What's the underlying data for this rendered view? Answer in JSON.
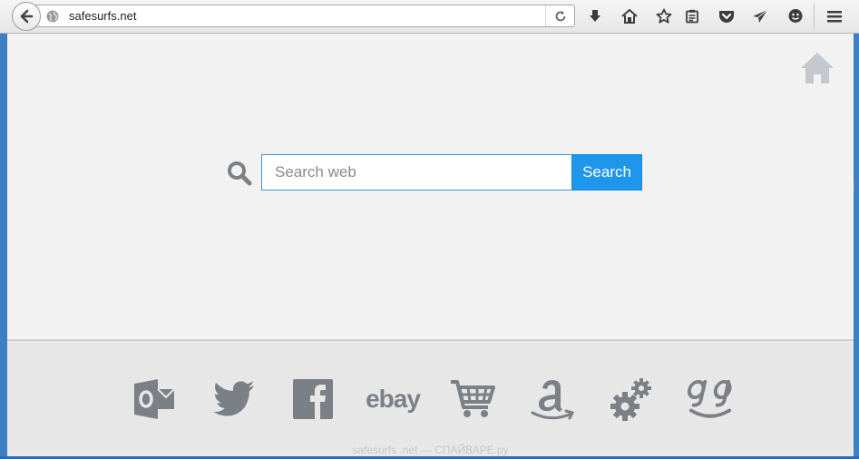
{
  "browser": {
    "url": "safesurfs.net",
    "toolbar_icons": [
      "download-icon",
      "home-icon",
      "bookmark-star-icon",
      "reading-list-icon",
      "pocket-icon",
      "send-icon",
      "hello-icon",
      "menu-icon"
    ]
  },
  "search": {
    "placeholder": "Search web",
    "value": "",
    "button_label": "Search",
    "accent_color": "#1e96ec"
  },
  "quick_links": [
    {
      "name": "outlook",
      "icon": "outlook-icon"
    },
    {
      "name": "twitter",
      "icon": "twitter-icon"
    },
    {
      "name": "facebook",
      "icon": "facebook-icon"
    },
    {
      "name": "ebay",
      "label": "ebay",
      "icon": "ebay-icon"
    },
    {
      "name": "shopping",
      "icon": "cart-icon"
    },
    {
      "name": "amazon",
      "icon": "amazon-icon"
    },
    {
      "name": "settings",
      "icon": "gears-icon"
    },
    {
      "name": "games",
      "icon": "gg-icon"
    }
  ],
  "footer": {
    "note": "safesurfs .net — СПАЙВАРЕ.ру"
  }
}
